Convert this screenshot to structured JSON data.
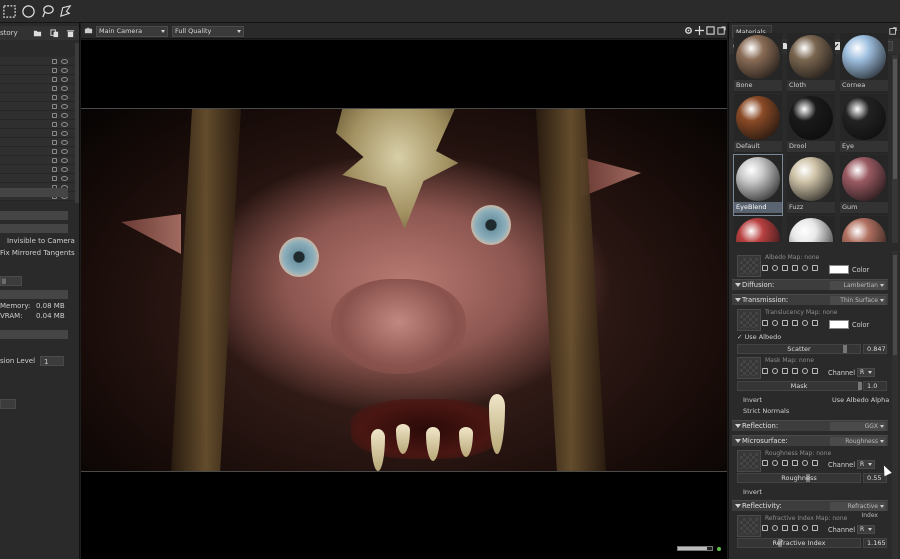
{
  "left_panel": {
    "title": "story",
    "labels": {
      "invisible_to_camera": "Invisible to Camera",
      "fix_mirrored_tangents": "Fix Mirrored Tangents",
      "dropdown_value": "ll",
      "memory_label": "Memory:",
      "memory_value": "0.08 MB",
      "vram_label": "VRAM:",
      "vram_value": "0.04 MB",
      "subdivision_label": "sion Level",
      "subdivision_value": "1"
    }
  },
  "viewport": {
    "camera_select": "Main Camera",
    "quality_select": "Full Quality",
    "progress": 0.85
  },
  "materials_panel": {
    "tab": "Materials",
    "count_value": "- / -",
    "materials": [
      {
        "name": "Bone",
        "color": "#8a6c56"
      },
      {
        "name": "Cloth",
        "color": "#7a6650"
      },
      {
        "name": "Cornea",
        "color": "#9fc0e0"
      },
      {
        "name": "Default",
        "color": "#8a4a26"
      },
      {
        "name": "Drool",
        "color": "#1a1a1a"
      },
      {
        "name": "Eye",
        "color": "#222222"
      },
      {
        "name": "EyeBlend",
        "color": "#c9c9c9"
      },
      {
        "name": "Fuzz",
        "color": "#cfc3a8"
      },
      {
        "name": "Gum",
        "color": "#9a5a62"
      }
    ],
    "selected": "EyeBlend",
    "albedo": {
      "map_label": "Albedo Map:",
      "map_value": "none",
      "color_label": "Color"
    },
    "diffusion": {
      "name": "Diffusion:",
      "mode": "Lambertian"
    },
    "transmission": {
      "name": "Transmission:",
      "mode": "Thin Surface",
      "map_label": "Translucency Map:",
      "map_value": "none",
      "color_label": "Color",
      "use_albedo": "Use Albedo",
      "scatter_label": "Scatter",
      "scatter_value": "0.847",
      "mask_map_label": "Mask Map:",
      "mask_map_value": "none",
      "channel_label": "Channel",
      "channel_value": "R",
      "mask_label": "Mask",
      "mask_value": "1.0",
      "invert": "Invert",
      "use_albedo_alpha": "Use Albedo Alpha",
      "strict_normals": "Strict Normals"
    },
    "reflection": {
      "name": "Reflection:",
      "mode": "GGX"
    },
    "microsurface": {
      "name": "Microsurface:",
      "mode": "Roughness",
      "map_label": "Roughness Map:",
      "map_value": "none",
      "channel_label": "Channel",
      "channel_value": "R",
      "roughness_label": "Roughness",
      "roughness_value": "0.55",
      "invert": "Invert"
    },
    "reflectivity": {
      "name": "Reflectivity:",
      "mode": "Refractive Index",
      "map_label": "Refractive Index Map:",
      "map_value": "none",
      "channel_label": "Channel",
      "channel_value": "R",
      "index_label": "Refractive Index",
      "index_value": "1.165"
    }
  }
}
